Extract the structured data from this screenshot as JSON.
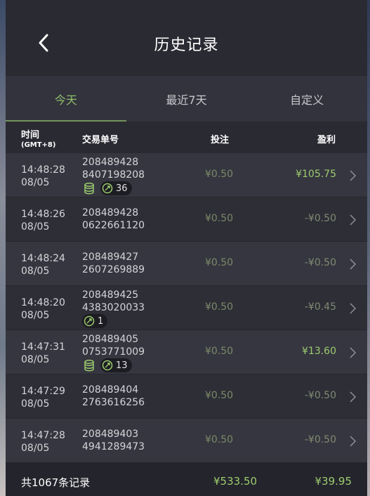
{
  "header": {
    "title": "历史记录"
  },
  "tabs": [
    {
      "label": "今天",
      "active": true
    },
    {
      "label": "最近7天",
      "active": false
    },
    {
      "label": "自定义",
      "active": false
    }
  ],
  "columns": {
    "time": "时间",
    "time_sub": "(GMT+8)",
    "order": "交易单号",
    "bet": "投注",
    "profit": "盈利"
  },
  "rows": [
    {
      "time": "14:48:28",
      "date": "08/05",
      "order1": "208489428",
      "order2": "8407198208",
      "bet": "¥0.50",
      "profit": "¥105.75",
      "win": true,
      "coins": true,
      "multi": "36"
    },
    {
      "time": "14:48:26",
      "date": "08/05",
      "order1": "208489428",
      "order2": "0622661120",
      "bet": "¥0.50",
      "profit": "-¥0.50",
      "win": false
    },
    {
      "time": "14:48:24",
      "date": "08/05",
      "order1": "208489427",
      "order2": "2607269889",
      "bet": "¥0.50",
      "profit": "-¥0.50",
      "win": false
    },
    {
      "time": "14:48:20",
      "date": "08/05",
      "order1": "208489425",
      "order2": "4383020033",
      "bet": "¥0.50",
      "profit": "-¥0.45",
      "win": false,
      "coins": false,
      "multi": "1"
    },
    {
      "time": "14:47:31",
      "date": "08/05",
      "order1": "208489405",
      "order2": "0753771009",
      "bet": "¥0.50",
      "profit": "¥13.60",
      "win": true,
      "coins": true,
      "multi": "13"
    },
    {
      "time": "14:47:29",
      "date": "08/05",
      "order1": "208489404",
      "order2": "2763616256",
      "bet": "¥0.50",
      "profit": "-¥0.50",
      "win": false
    },
    {
      "time": "14:47:28",
      "date": "08/05",
      "order1": "208489403",
      "order2": "4941289473",
      "bet": "¥0.50",
      "profit": "-¥0.50",
      "win": false
    }
  ],
  "footer": {
    "total_label": "共1067条记录",
    "total_bet": "¥533.50",
    "total_profit": "¥39.95"
  },
  "colors": {
    "accent_green": "#8fbf6a",
    "win_green": "#9ccc6e",
    "background": "#2c2c35"
  },
  "icons": {
    "back": "chevron-left-icon",
    "row_arrow": "chevron-right-icon",
    "coins": "coin-stack-icon",
    "multiplier": "multiplier-circle-icon"
  }
}
